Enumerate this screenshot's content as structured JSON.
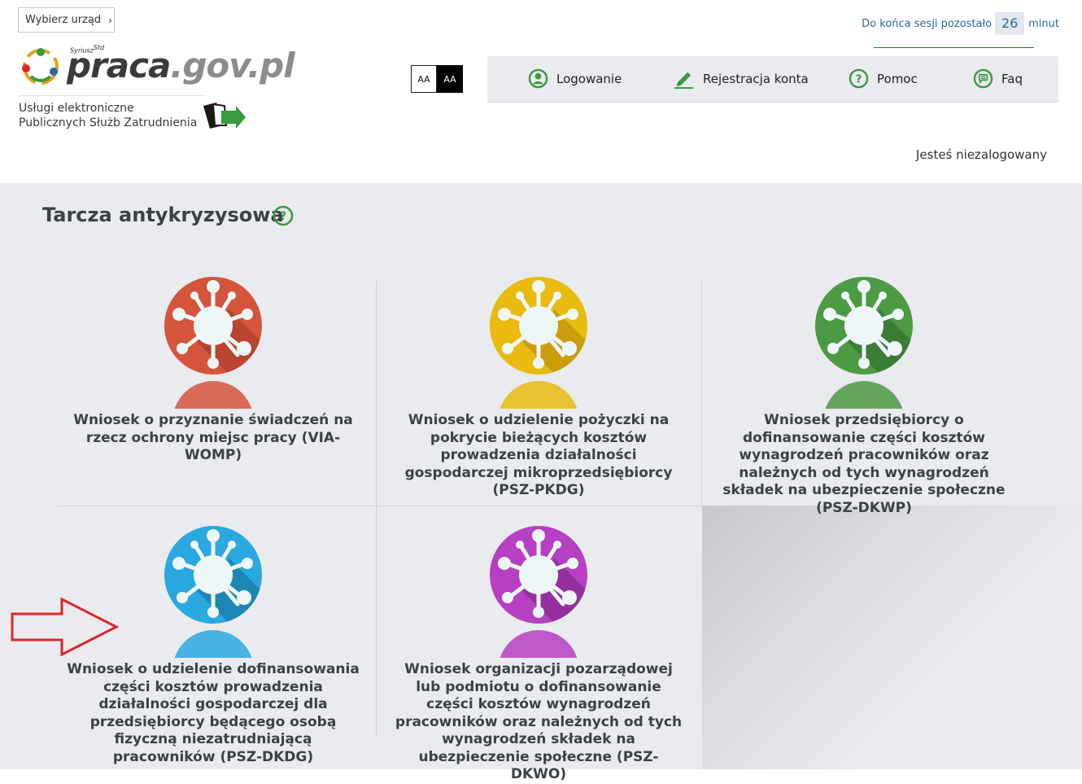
{
  "header": {
    "office_button": "Wybierz urząd",
    "logo": {
      "brand_small": "Syriusz",
      "brand_sup": "Std",
      "brand_dark": "praca",
      "brand_light": ".gov.pl"
    },
    "services_line1": "Usługi elektroniczne",
    "services_line2": "Publicznych Służb Zatrudnienia",
    "contrast": {
      "light": "AA",
      "dark": "AA"
    },
    "session": {
      "prefix": "Do końca sesji pozostało",
      "minutes": "26",
      "suffix": "minut"
    },
    "nav": [
      {
        "label": "Logowanie",
        "icon": "user-circle-icon"
      },
      {
        "label": "Rejestracja konta",
        "icon": "pencil-icon"
      },
      {
        "label": "Pomoc",
        "icon": "question-circle-icon"
      },
      {
        "label": "Faq",
        "icon": "chat-bubble-icon"
      }
    ],
    "status": "Jesteś niezalogowany"
  },
  "main": {
    "title": "Tarcza antykryzysowa",
    "tiles": [
      {
        "label": "Wniosek o przyznanie świadczeń na rzecz ochrony miejsc pracy (VIA-WOMP)",
        "color": "#d5553c",
        "shade": "#b94430"
      },
      {
        "label": "Wniosek o udzielenie pożyczki na pokrycie bieżących kosztów prowadzenia działalności gospodarczej mikroprzedsiębiorcy (PSZ-PKDG)",
        "color": "#e8bb0e",
        "shade": "#c99e0a"
      },
      {
        "label": "Wniosek przedsiębiorcy o dofinansowanie części kosztów wynagrodzeń pracowników oraz należnych od tych wynagrodzeń składek na ubezpieczenie społeczne (PSZ-DKWP)",
        "color": "#4d9a45",
        "shade": "#3b7d35"
      },
      {
        "label": "Wniosek o udzielenie dofinansowania części kosztów prowadzenia działalności gospodarczej dla przedsiębiorcy będącego osobą fizyczną niezatrudniającą pracowników (PSZ-DKDG)",
        "color": "#29a9e0",
        "shade": "#1c87b5"
      },
      {
        "label": "Wniosek organizacji pozarządowej lub podmiotu o dofinansowanie części kosztów wynagrodzeń pracowników oraz należnych od tych wynagrodzeń składek na ubezpieczenie społeczne (PSZ-DKWO)",
        "color": "#b63fc2",
        "shade": "#93309e"
      }
    ]
  },
  "colors": {
    "accent_green": "#3a9a3e",
    "session_blue": "#2d6a9c",
    "arrow_red": "#e0252a",
    "panel_bg": "#e9ebee"
  }
}
